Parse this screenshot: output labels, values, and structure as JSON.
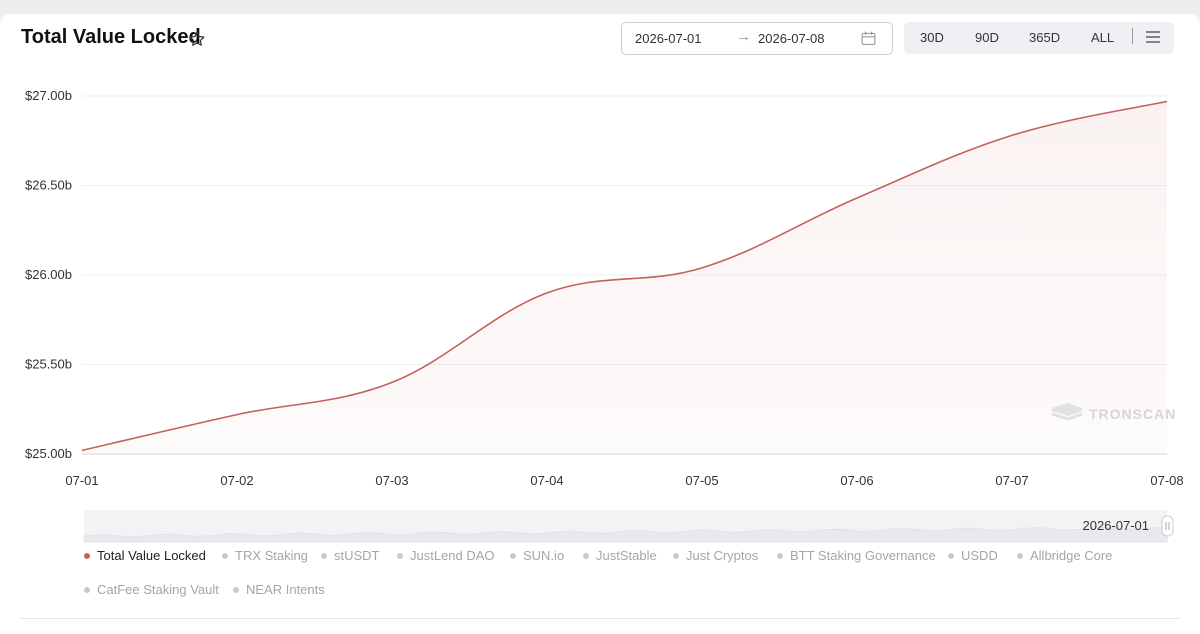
{
  "header": {
    "title": "Total Value Locked",
    "date_start": "2026-07-01",
    "date_arrow": "→",
    "date_end": "2026-07-08",
    "ranges": [
      "30D",
      "90D",
      "365D",
      "ALL"
    ]
  },
  "watermark": "TRONSCAN",
  "slider": {
    "handle_label": "2026-07-01"
  },
  "legend": [
    "Total Value Locked",
    "TRX Staking",
    "stUSDT",
    "JustLend DAO",
    "SUN.io",
    "JustStable",
    "Just Cryptos",
    "BTT Staking Governance",
    "USDD",
    "Allbridge Core",
    "CatFee Staking Vault",
    "NEAR Intents"
  ],
  "colors": {
    "line": "#c4615b",
    "accent_dot": "#c4615b",
    "inactive_dot": "#c5cad0"
  },
  "chart_data": {
    "type": "area",
    "categories": [
      "07-01",
      "07-02",
      "07-03",
      "07-04",
      "07-05",
      "07-06",
      "07-07",
      "07-08"
    ],
    "series": [
      {
        "name": "Total Value Locked",
        "values": [
          25.02,
          25.22,
          25.4,
          25.9,
          26.04,
          26.43,
          26.78,
          26.97
        ]
      }
    ],
    "y_ticks": [
      "$25.00b",
      "$25.50b",
      "$26.00b",
      "$26.50b",
      "$27.00b"
    ],
    "ylim": [
      25.0,
      27.0
    ],
    "grid": true
  }
}
